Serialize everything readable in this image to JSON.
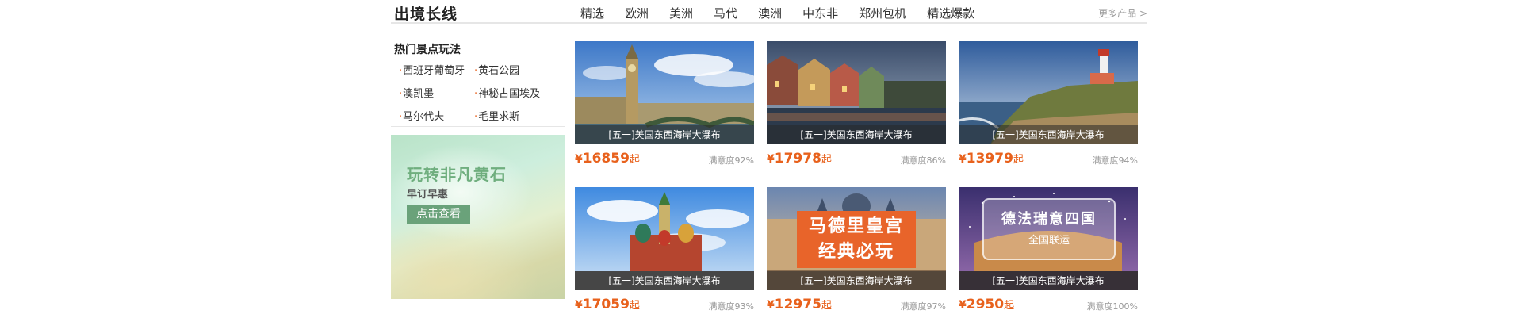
{
  "header": {
    "title": "出境长线",
    "nav": [
      "精选",
      "欧洲",
      "美洲",
      "马代",
      "澳洲",
      "中东非",
      "郑州包机",
      "精选爆款"
    ],
    "more": "更多产品 >"
  },
  "hot": {
    "title": "热门景点玩法",
    "links": [
      "西班牙葡萄牙",
      "黄石公园",
      "澳凯墨",
      "神秘古国埃及",
      "马尔代夫",
      "毛里求斯"
    ]
  },
  "promo": {
    "title": "玩转非凡黄石",
    "subtitle": "早订早惠",
    "button": "点击查看"
  },
  "cards": [
    {
      "caption": "[五一]美国东西海岸大瀑布",
      "currency": "¥",
      "price": "16859",
      "unit": "起",
      "satisfaction": "满意度92%",
      "image": "big-ben-london"
    },
    {
      "caption": "[五一]美国东西海岸大瀑布",
      "currency": "¥",
      "price": "17978",
      "unit": "起",
      "satisfaction": "满意度86%",
      "image": "colmar-canal-town"
    },
    {
      "caption": "[五一]美国东西海岸大瀑布",
      "currency": "¥",
      "price": "13979",
      "unit": "起",
      "satisfaction": "满意度94%",
      "image": "cabo-da-roca-lighthouse"
    },
    {
      "caption": "[五一]美国东西海岸大瀑布",
      "currency": "¥",
      "price": "17059",
      "unit": "起",
      "satisfaction": "满意度93%",
      "image": "st-basils-cathedral"
    },
    {
      "caption": "[五一]美国东西海岸大瀑布",
      "currency": "¥",
      "price": "12975",
      "unit": "起",
      "satisfaction": "满意度97%",
      "image": "madrid-royal-palace",
      "overlay": [
        "马德里皇宫",
        "经典必玩"
      ]
    },
    {
      "caption": "[五一]美国东西海岸大瀑布",
      "currency": "¥",
      "price": "2950",
      "unit": "起",
      "satisfaction": "满意度100%",
      "image": "colosseum-night",
      "overlay": [
        "德法瑞意四国",
        "全国联运"
      ]
    }
  ],
  "colors": {
    "accent": "#e8611c",
    "promo_button": "#6aa27a",
    "promo_title": "#6fae7e"
  }
}
